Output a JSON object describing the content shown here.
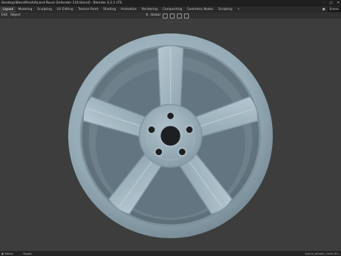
{
  "window": {
    "title": "Desktop\\BlendProd\\4\\Land Rover Defender 110.blend] - Blender 4.2.1 LTS"
  },
  "menubar": {
    "tabs": [
      {
        "label": "Layout",
        "active": true
      },
      {
        "label": "Modeling"
      },
      {
        "label": "Sculpting"
      },
      {
        "label": "UV Editing"
      },
      {
        "label": "Texture Paint"
      },
      {
        "label": "Shading"
      },
      {
        "label": "Animation"
      },
      {
        "label": "Rendering"
      },
      {
        "label": "Compositing"
      },
      {
        "label": "Geometry Nodes"
      },
      {
        "label": "Scripting"
      }
    ],
    "add_tab": "+",
    "scene": "Scene"
  },
  "header": {
    "menus": [
      "Edit",
      "Object"
    ],
    "orientation": "Global"
  },
  "statusbar": {
    "select": "Select",
    "box": "Object",
    "stats": "Scene_wheels | Verts 63 |"
  },
  "colors": {
    "viewport": "#3d3d3d",
    "wheel_base": "#93a9b4"
  },
  "icons": [
    "minimize-icon",
    "maximize-icon",
    "close-icon",
    "scene-icon",
    "mouse-icon"
  ]
}
